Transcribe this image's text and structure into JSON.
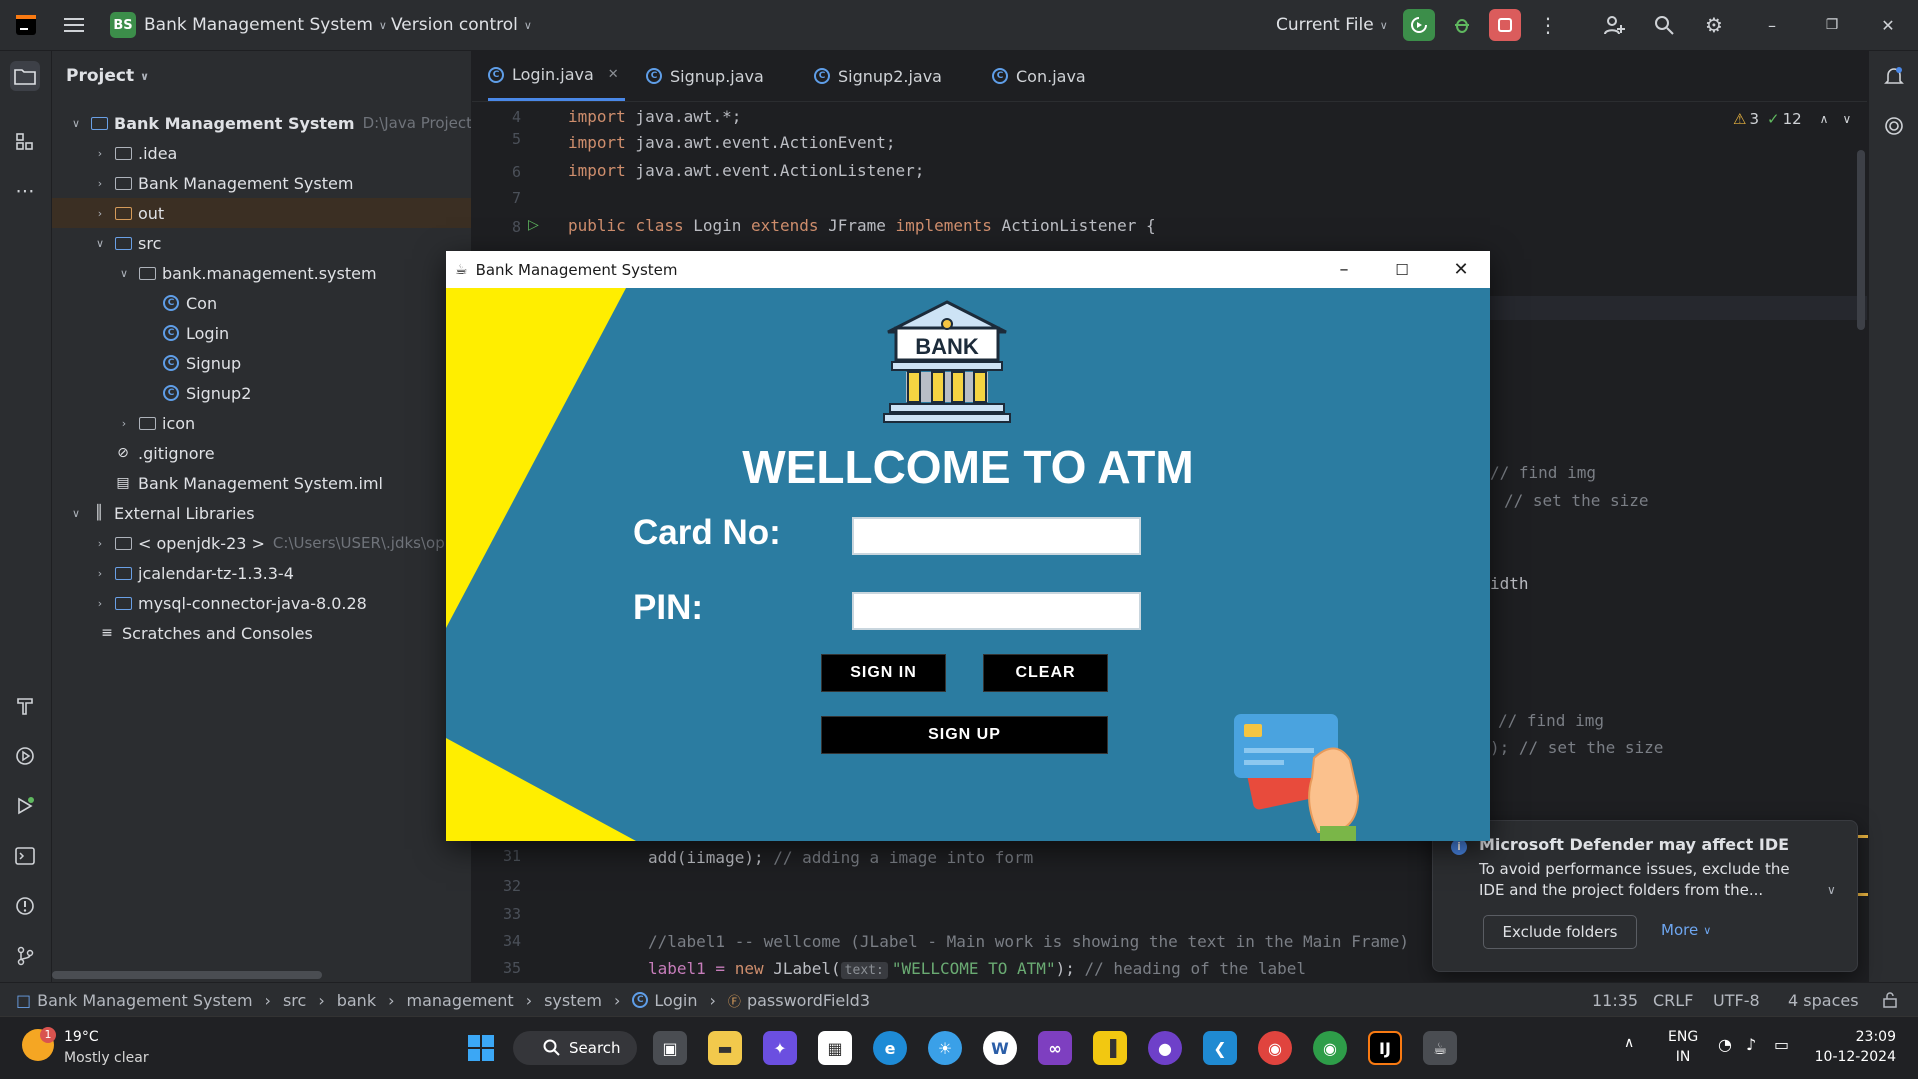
{
  "titlebar": {
    "project_badge": "BS",
    "project_name": "Bank Management System",
    "vcs": "Version control",
    "run_config": "Current File"
  },
  "project_panel": {
    "title": "Project",
    "tree": [
      {
        "label": "Bank Management System",
        "extra": "D:\\Java Project\\"
      },
      {
        "label": ".idea"
      },
      {
        "label": "Bank Management System"
      },
      {
        "label": "out"
      },
      {
        "label": "src"
      },
      {
        "label": "bank.management.system"
      },
      {
        "label": "Con"
      },
      {
        "label": "Login"
      },
      {
        "label": "Signup"
      },
      {
        "label": "Signup2"
      },
      {
        "label": "icon"
      },
      {
        "label": ".gitignore"
      },
      {
        "label": "Bank Management System.iml"
      },
      {
        "label": "External Libraries"
      },
      {
        "label": "< openjdk-23 >",
        "extra": "C:\\Users\\USER\\.jdks\\op"
      },
      {
        "label": "jcalendar-tz-1.3.3-4"
      },
      {
        "label": "mysql-connector-java-8.0.28"
      },
      {
        "label": "Scratches and Consoles"
      }
    ]
  },
  "tabs": [
    {
      "label": "Login.java"
    },
    {
      "label": "Signup.java"
    },
    {
      "label": "Signup2.java"
    },
    {
      "label": "Con.java"
    }
  ],
  "editor": {
    "warnings": "3",
    "checks": "12",
    "line_numbers": [
      "4",
      "5",
      "6",
      "7",
      "8",
      "31",
      "32",
      "33",
      "34",
      "35"
    ],
    "import1": "import",
    "import1_rest": " java.awt.*;",
    "import2_rest": " java.awt.event.ActionEvent;",
    "import3_rest": " java.awt.event.ActionListener;",
    "class_public": "public",
    "class_class": "class",
    "class_name": " Login ",
    "class_extends": "extends",
    "class_jframe": " JFrame ",
    "class_implements": "implements",
    "class_rest": " ActionListener {",
    "frag_find_img_1": "// find img",
    "frag_set_size_1": "// set the size",
    "frag_width": "idth",
    "frag_find_img_2": "// find img",
    "frag_set_size_2": "); // set the size",
    "line31_code": "add(iimage);",
    "line31_comment": " // adding a image into form",
    "line34_comment": "//label1 -- wellcome (JLabel - Main work is showing the text in the Main Frame)",
    "line35_a": "label1 = ",
    "line35_new": "new",
    "line35_b": " JLabel(",
    "line35_hint": "text:",
    "line35_str": "\"WELLCOME TO ATM\"",
    "line35_c": "); ",
    "line35_comment": "// heading of the label"
  },
  "swing": {
    "title": "Bank Management System",
    "bank_sign": "BANK",
    "heading": "WELLCOME TO ATM",
    "card_label": "Card No:",
    "pin_label": "PIN:",
    "signin": "SIGN IN",
    "clear": "CLEAR",
    "signup": "SIGN UP",
    "colors": {
      "background": "#2b7ca1",
      "accent": "#ffee00"
    }
  },
  "notification": {
    "title": "Microsoft Defender may affect IDE",
    "body": "To avoid performance issues, exclude the IDE and the project folders from the...",
    "action": "Exclude folders",
    "more": "More"
  },
  "statusbar": {
    "crumbs": [
      "Bank Management System",
      "src",
      "bank",
      "management",
      "system",
      "Login",
      "passwordField3"
    ],
    "position": "11:35",
    "line_sep": "CRLF",
    "encoding": "UTF-8",
    "indent": "4 spaces"
  },
  "taskbar": {
    "temp": "19°C",
    "weather": "Mostly clear",
    "weather_badge": "1",
    "search": "Search",
    "lang1": "ENG",
    "lang2": "IN",
    "time": "23:09",
    "date": "10-12-2024"
  }
}
